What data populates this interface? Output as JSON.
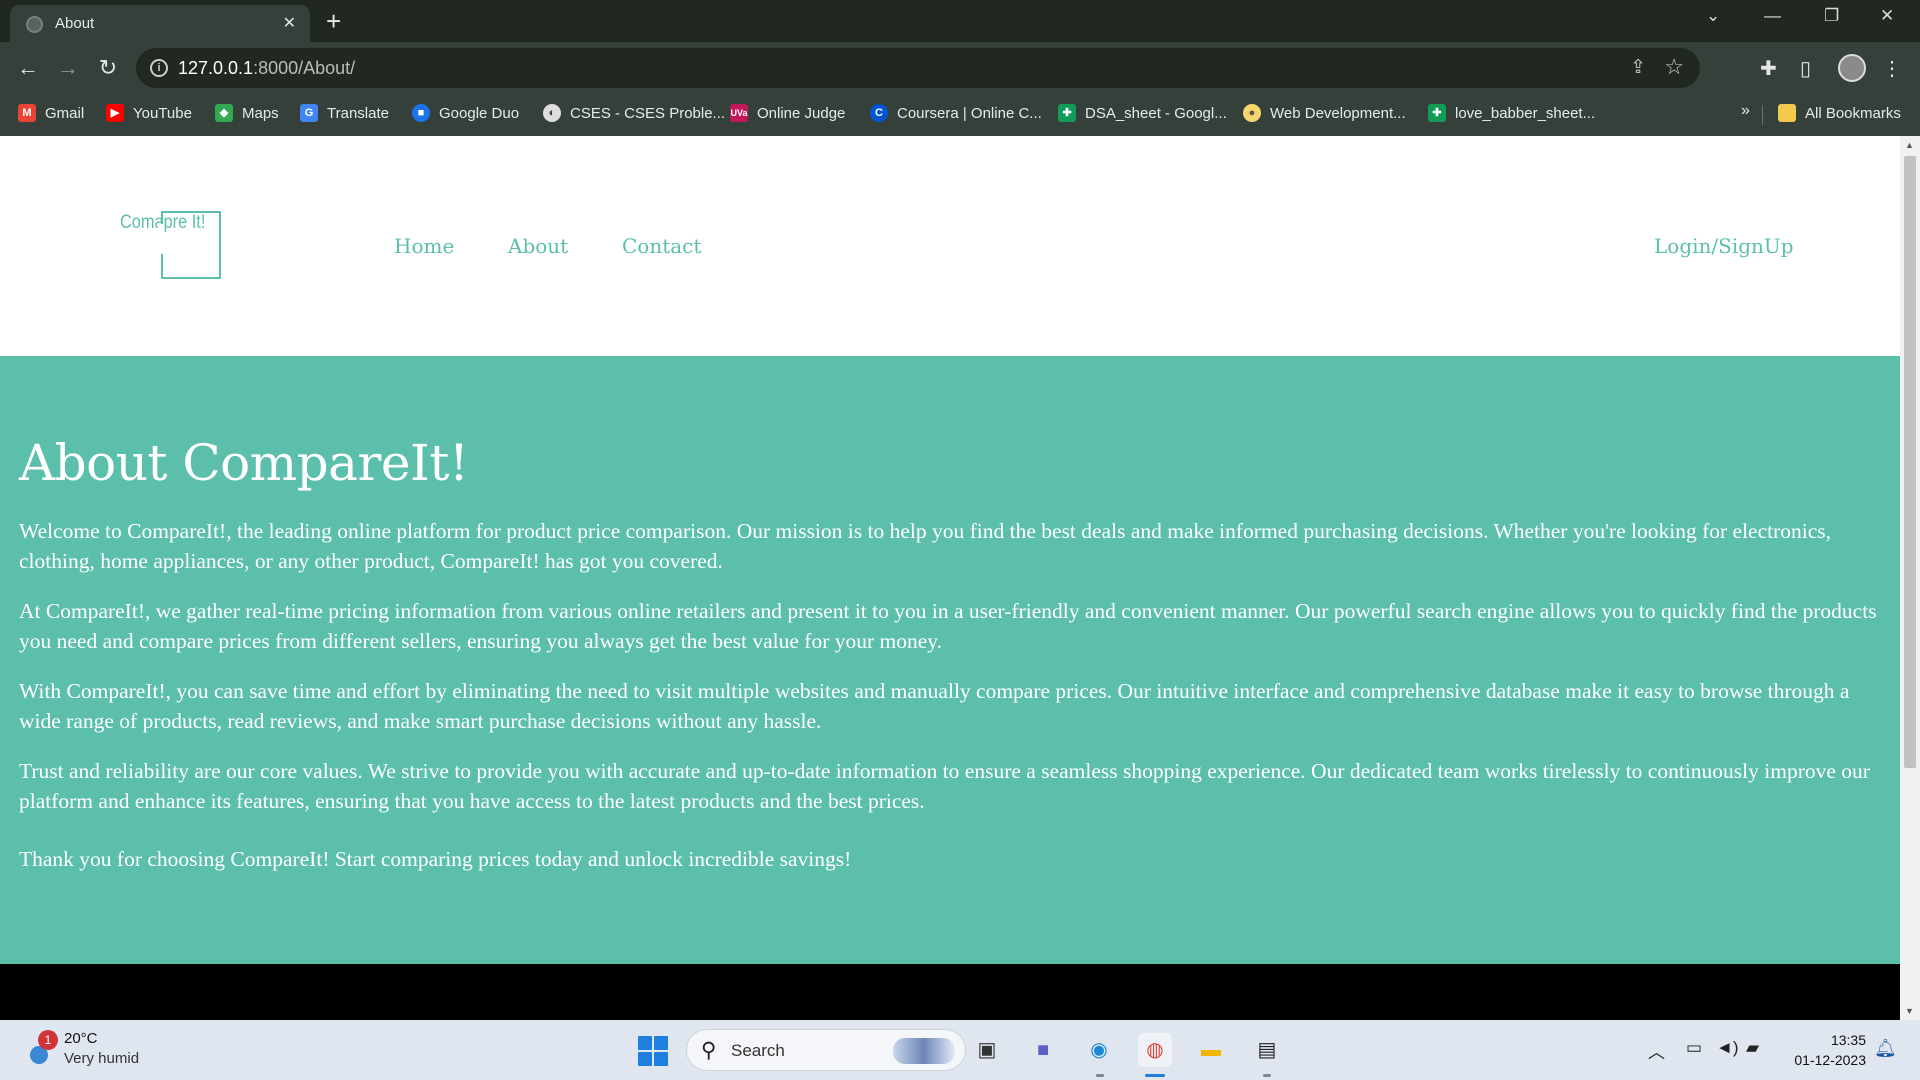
{
  "browser": {
    "tab_title": "About",
    "url_host": "127.0.0.1",
    "url_path": ":8000/About/",
    "bookmarks": [
      {
        "label": "Gmail",
        "icon": "gmail-icon",
        "color": "#ea4335"
      },
      {
        "label": "YouTube",
        "icon": "youtube-icon",
        "color": "#ff0000"
      },
      {
        "label": "Maps",
        "icon": "maps-icon",
        "color": "#34a853"
      },
      {
        "label": "Translate",
        "icon": "translate-icon",
        "color": "#4285f4"
      },
      {
        "label": "Google Duo",
        "icon": "duo-icon",
        "color": "#1a73e8"
      },
      {
        "label": "CSES - CSES Proble...",
        "icon": "globe-icon",
        "color": "#dddddd"
      },
      {
        "label": "Online Judge",
        "icon": "uva-icon",
        "color": "#c2185b"
      },
      {
        "label": "Coursera | Online C...",
        "icon": "coursera-icon",
        "color": "#0056d2"
      },
      {
        "label": "DSA_sheet - Googl...",
        "icon": "sheets-icon",
        "color": "#0f9d58"
      },
      {
        "label": "Web Development...",
        "icon": "web-dev-icon",
        "color": "#f5d76e"
      },
      {
        "label": "love_babber_sheet...",
        "icon": "sheets-icon",
        "color": "#0f9d58"
      }
    ],
    "more_label": "»",
    "all_bookmarks_label": "All Bookmarks"
  },
  "site": {
    "logo_text": "Comapre It!",
    "nav": [
      "Home",
      "About",
      "Contact"
    ],
    "login_label": "Login/SignUp",
    "accent_color": "#5bbfac"
  },
  "about": {
    "heading": "About CompareIt!",
    "paragraphs": [
      "Welcome to CompareIt!, the leading online platform for product price comparison. Our mission is to help you find the best deals and make informed purchasing decisions. Whether you're looking for electronics, clothing, home appliances, or any other product, CompareIt! has got you covered.",
      "At CompareIt!, we gather real-time pricing information from various online retailers and present it to you in a user-friendly and convenient manner. Our powerful search engine allows you to quickly find the products you need and compare prices from different sellers, ensuring you always get the best value for your money.",
      "With CompareIt!, you can save time and effort by eliminating the need to visit multiple websites and manually compare prices. Our intuitive interface and comprehensive database make it easy to browse through a wide range of products, read reviews, and make smart purchase decisions without any hassle.",
      "Trust and reliability are our core values. We strive to provide you with accurate and up-to-date information to ensure a seamless shopping experience. Our dedicated team works tirelessly to continuously improve our platform and enhance its features, ensuring that you have access to the latest products and the best prices.",
      "Thank you for choosing CompareIt! Start comparing prices today and unlock incredible savings!"
    ]
  },
  "taskbar": {
    "weather_temp": "20°C",
    "weather_cond": "Very humid",
    "weather_badge": "1",
    "search_label": "Search",
    "time": "13:35",
    "date": "01-12-2023"
  }
}
